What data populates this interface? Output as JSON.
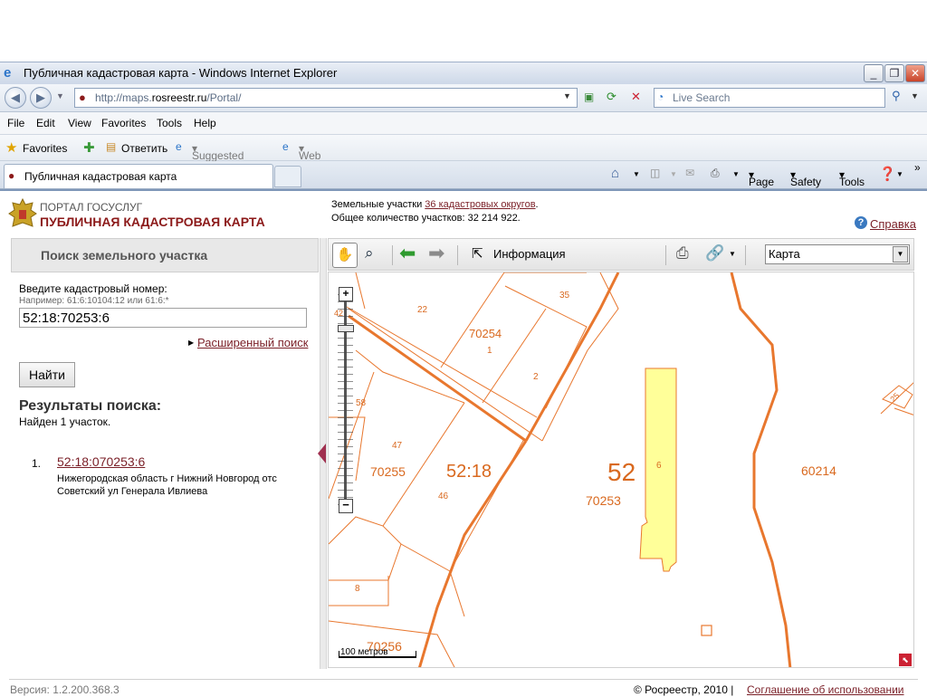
{
  "browser": {
    "title": "Публичная кадастровая карта - Windows Internet Explorer",
    "url_prefix": "http://maps.",
    "url_domain": "rosreestr.ru",
    "url_path": "/Portal/",
    "search_placeholder": "Live Search",
    "menu": [
      "File",
      "Edit",
      "View",
      "Favorites",
      "Tools",
      "Help"
    ],
    "favorites": {
      "label": "Favorites",
      "reply": "Ответить",
      "suggested": "Suggested Sites",
      "webslice": "Web Slice Gallery"
    },
    "tab_title": "Публичная кадастровая карта",
    "commands": {
      "page": "Page",
      "safety": "Safety",
      "tools": "Tools"
    }
  },
  "header": {
    "portal": "ПОРТАЛ ГОСУСЛУГ",
    "title": "ПУБЛИЧНАЯ КАДАСТРОВАЯ КАРТА",
    "stats_line1_prefix": "Земельные участки",
    "stats_link": "36 кадастровых округов",
    "stats_line1_suffix": ".",
    "stats_line2": "Общее количество участков: 32 214 922.",
    "help": "Справка"
  },
  "sidebar": {
    "heading": "Поиск земельного участка",
    "input_label": "Введите кадастровый номер:",
    "input_hint": "Например: 61:6:10104:12 или 61:6:*",
    "input_value": "52:18:70253:6",
    "advanced": "Расширенный поиск",
    "find_button": "Найти",
    "results_heading": "Результаты поиска:",
    "found": "Найден 1 участок.",
    "results": [
      {
        "num": "1.",
        "link": "52:18:070253:6",
        "addr1": "Нижегородская область г Нижний Новгород отс",
        "addr2": "Советский ул Генерала Ивлиева"
      }
    ]
  },
  "map": {
    "info_label": "Информация",
    "map_type": "Карта",
    "scale": "100 метров",
    "labels": [
      "22",
      "35",
      "70254",
      "1",
      "2",
      "42",
      "58",
      "47",
      "70255",
      "52:18",
      "46",
      "52",
      "6",
      "70253",
      "60214",
      "25",
      "8",
      "70256"
    ],
    "colors": {
      "parcel": "#e8772e",
      "selected_fill": "#ffff99",
      "link": "#7a1f27"
    }
  },
  "footer": {
    "version": "Версия: 1.2.200.368.3",
    "copyright": "© Росреестр, 2010 |",
    "agreement": "Соглашение об использовании"
  }
}
